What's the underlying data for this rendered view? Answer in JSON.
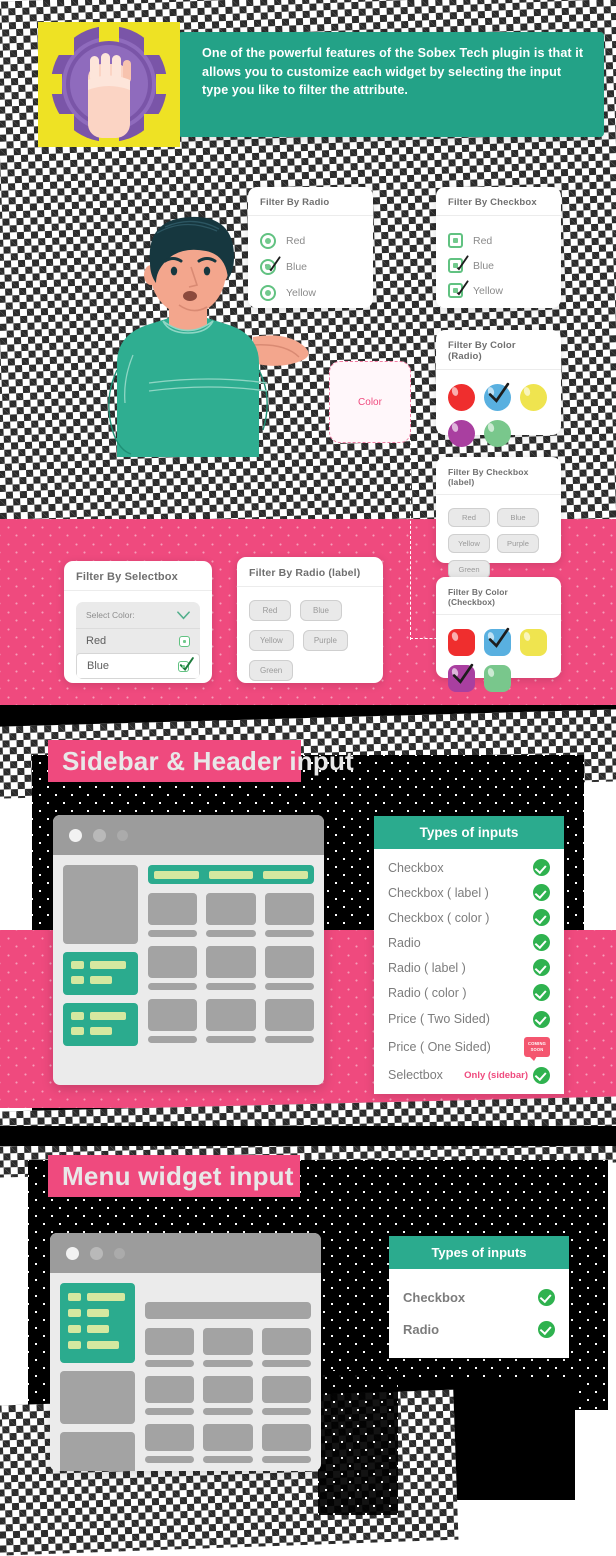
{
  "banner": {
    "text": "One of the powerful features of the Sobex Tech plugin is that it allows you to customize each widget by selecting the input type you like to filter the attribute.",
    "icon": "fist-badge-icon",
    "bg_color": "#23a287"
  },
  "colors": {
    "pink": "#ef4a7e",
    "teal": "#2bab8e",
    "banner_teal": "#23a287",
    "green_check": "#2fb24f",
    "soon_red": "#f4566f",
    "swatch_red": "#ef2e2e",
    "swatch_blue": "#59b0e0",
    "swatch_yellow": "#efe44f",
    "swatch_purple": "#a93fa0",
    "swatch_green": "#79c78c"
  },
  "cards": {
    "filter_by_radio": {
      "title": "Filter By Radio",
      "options": [
        {
          "label": "Red",
          "checked": false
        },
        {
          "label": "Blue",
          "checked": true
        },
        {
          "label": "Yellow",
          "checked": false
        }
      ]
    },
    "filter_by_checkbox": {
      "title": "Filter By Checkbox",
      "options": [
        {
          "label": "Red",
          "checked": false
        },
        {
          "label": "Blue",
          "checked": true
        },
        {
          "label": "Yellow",
          "checked": true
        }
      ]
    },
    "filter_by_color_radio": {
      "title": "Filter By Color (Radio)",
      "swatches": [
        {
          "label": "Red",
          "color": "#ef2e2e",
          "checked": false
        },
        {
          "label": "Blue",
          "color": "#59b0e0",
          "checked": true
        },
        {
          "label": "Yellow",
          "color": "#efe44f",
          "checked": false
        },
        {
          "label": "Purple",
          "color": "#a93fa0",
          "checked": false
        },
        {
          "label": "Green",
          "color": "#79c78c",
          "checked": false
        }
      ]
    },
    "filter_by_checkbox_label": {
      "title": "Filter By Checkbox (label)",
      "pills": [
        "Red",
        "Blue",
        "Yellow",
        "Purple",
        "Green"
      ]
    },
    "filter_by_selectbox": {
      "title": "Filter By Selectbox",
      "placeholder": "Select Color:",
      "options": [
        {
          "label": "Red",
          "checked": false
        },
        {
          "label": "Blue",
          "checked": true
        }
      ]
    },
    "filter_by_radio_label": {
      "title": "Filter By Radio (label)",
      "pills": [
        "Red",
        "Blue",
        "Yellow",
        "Purple",
        "Green"
      ]
    },
    "filter_by_color_checkbox": {
      "title": "Filter By Color (Checkbox)",
      "swatches": [
        {
          "label": "Red",
          "color": "#ef2e2e",
          "checked": false
        },
        {
          "label": "Blue",
          "color": "#59b0e0",
          "checked": true
        },
        {
          "label": "Yellow",
          "color": "#efe44f",
          "checked": false
        },
        {
          "label": "Purple",
          "color": "#a93fa0",
          "checked": true
        },
        {
          "label": "Green",
          "color": "#79c78c",
          "checked": false
        }
      ]
    }
  },
  "color_box": {
    "label": "Color"
  },
  "sections": [
    {
      "title": "Sidebar & Header input",
      "table": {
        "header": "Types of inputs",
        "rows": [
          {
            "label": "Checkbox",
            "status": "check",
            "note": ""
          },
          {
            "label": "Checkbox ( label )",
            "status": "check",
            "note": ""
          },
          {
            "label": "Checkbox ( color )",
            "status": "check",
            "note": ""
          },
          {
            "label": "Radio",
            "status": "check",
            "note": ""
          },
          {
            "label": "Radio ( label )",
            "status": "check",
            "note": ""
          },
          {
            "label": "Radio ( color )",
            "status": "check",
            "note": ""
          },
          {
            "label": "Price ( Two Sided)",
            "status": "check",
            "note": ""
          },
          {
            "label": "Price ( One Sided)",
            "status": "coming-soon",
            "note": ""
          },
          {
            "label": "Selectbox",
            "status": "check",
            "note": "Only (sidebar)"
          }
        ]
      }
    },
    {
      "title": "Menu widget input",
      "table": {
        "header": "Types of inputs",
        "rows": [
          {
            "label": "Checkbox",
            "status": "check",
            "note": ""
          },
          {
            "label": "Radio",
            "status": "check",
            "note": ""
          }
        ]
      }
    }
  ],
  "coming_soon_badge": {
    "line1": "COMING",
    "line2": "SOON"
  },
  "browser_mock": {
    "dots": [
      "#f2f2f2",
      "#b9b9b9",
      "#ababab"
    ]
  },
  "illustration": {
    "name": "man-shrugging-illustration"
  }
}
